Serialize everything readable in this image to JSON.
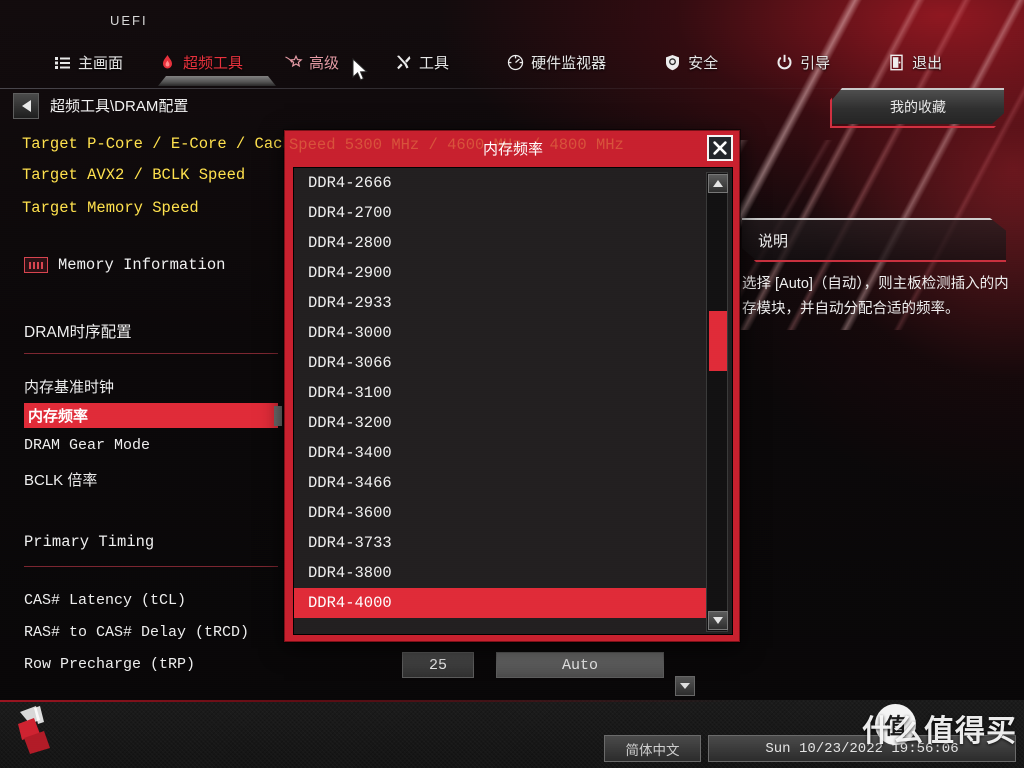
{
  "brand": "UEFI",
  "nav": {
    "items": [
      {
        "label": "主画面",
        "icon": "list-icon",
        "state": "normal"
      },
      {
        "label": "超频工具",
        "icon": "flame-icon",
        "state": "active"
      },
      {
        "label": "高级",
        "icon": "star-icon",
        "state": "hover"
      },
      {
        "label": "工具",
        "icon": "wrench-icon",
        "state": "normal"
      },
      {
        "label": "硬件监视器",
        "icon": "gauge-icon",
        "state": "normal"
      },
      {
        "label": "安全",
        "icon": "shield-icon",
        "state": "normal"
      },
      {
        "label": "引导",
        "icon": "power-icon",
        "state": "normal"
      },
      {
        "label": "退出",
        "icon": "exit-door-icon",
        "state": "normal"
      }
    ]
  },
  "breadcrumb": "超频工具\\DRAM配置",
  "favorites_button": "我的收藏",
  "content": {
    "target_rows": [
      "Target P-Core / E-Core / Cache Speed",
      "Target AVX2 / BCLK Speed",
      "Target Memory Speed"
    ],
    "memory_information": "Memory Information",
    "section_dram_timing": "DRAM时序配置",
    "section_primary_timing": "Primary Timing",
    "rows": [
      "内存基准时钟",
      "内存频率",
      "DRAM Gear Mode",
      "BCLK 倍率",
      "CAS# Latency (tCL)",
      "RAS# to CAS# Delay (tRCD)",
      "Row Precharge (tRP)"
    ],
    "selected_row": "内存频率",
    "field_number_value": "25",
    "field_auto_value": "Auto"
  },
  "help": {
    "title": "说明",
    "body": "选择 [Auto]（自动），则主板检测插入的内存模块，并自动分配合适的频率。"
  },
  "modal": {
    "title": "内存频率",
    "ghost_text": "Speed          5300 MHz / 4600 MHz / 4800 MHz",
    "close_icon": "close-icon",
    "options": [
      "DDR4-2666",
      "DDR4-2700",
      "DDR4-2800",
      "DDR4-2900",
      "DDR4-2933",
      "DDR4-3000",
      "DDR4-3066",
      "DDR4-3100",
      "DDR4-3200",
      "DDR4-3400",
      "DDR4-3466",
      "DDR4-3600",
      "DDR4-3733",
      "DDR4-3800",
      "DDR4-4000"
    ],
    "selected_option": "DDR4-4000",
    "scroll_up_icon": "triangle-up-icon",
    "scroll_down_icon": "triangle-down-icon"
  },
  "bottom": {
    "language": "简体中文",
    "datetime": "Sun 10/23/2022  19:56:06",
    "watermark": "什么值得买",
    "watermark_badge": "值"
  },
  "colors": {
    "accent_red": "#e02b38",
    "modal_red": "#c8202e",
    "yellow": "#ffe14d"
  }
}
